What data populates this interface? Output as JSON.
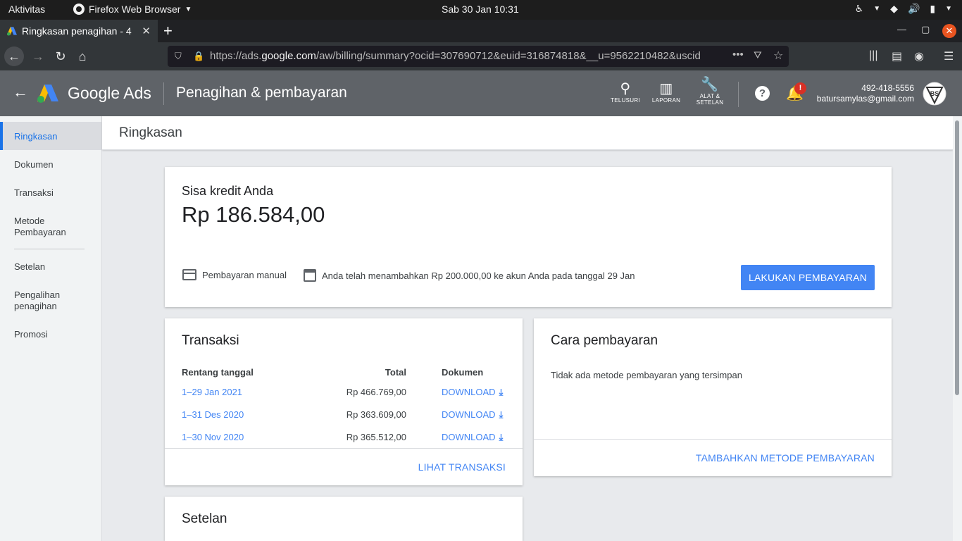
{
  "system_bar": {
    "activities": "Aktivitas",
    "app_name": "Firefox Web Browser",
    "clock": "Sab 30 Jan  10:31"
  },
  "browser": {
    "tab_title": "Ringkasan penagihan - 4",
    "url_prefix": "https://ads.",
    "url_domain": "google.com",
    "url_path": "/aw/billing/summary?ocid=307690712&euid=316874818&__u=9562210482&uscid"
  },
  "ads_header": {
    "brand": "Google Ads",
    "page_title": "Penagihan & pembayaran",
    "tools": {
      "search_label": "TELUSURI",
      "reports_label": "LAPORAN",
      "settings_label_1": "ALAT &",
      "settings_label_2": "SETELAN"
    },
    "notification_badge": "!",
    "account_phone": "492-418-5556",
    "account_email": "batursamylas@gmail.com",
    "avatar_initials": "BS"
  },
  "sidebar": {
    "items": [
      {
        "label": "Ringkasan"
      },
      {
        "label": "Dokumen"
      },
      {
        "label": "Transaksi"
      },
      {
        "label": "Metode Pembayaran"
      },
      {
        "label": "Setelan"
      },
      {
        "label": "Pengalihan penagihan"
      },
      {
        "label": "Promosi"
      }
    ]
  },
  "page": {
    "title": "Ringkasan"
  },
  "credit_card": {
    "label": "Sisa kredit Anda",
    "amount": "Rp 186.584,00",
    "payment_type": "Pembayaran manual",
    "last_payment_note": "Anda telah menambahkan Rp 200.000,00 ke akun Anda pada tanggal 29 Jan",
    "pay_button": "LAKUKAN PEMBAYARAN"
  },
  "transactions": {
    "title": "Transaksi",
    "headers": {
      "range": "Rentang tanggal",
      "total": "Total",
      "document": "Dokumen"
    },
    "rows": [
      {
        "range": "1–29 Jan 2021",
        "total": "Rp 466.769,00",
        "download": "DOWNLOAD"
      },
      {
        "range": "1–31 Des 2020",
        "total": "Rp 363.609,00",
        "download": "DOWNLOAD"
      },
      {
        "range": "1–30 Nov 2020",
        "total": "Rp 365.512,00",
        "download": "DOWNLOAD"
      }
    ],
    "view_link": "LIHAT TRANSAKSI"
  },
  "payment_methods": {
    "title": "Cara pembayaran",
    "empty_text": "Tidak ada metode pembayaran yang tersimpan",
    "add_link": "TAMBAHKAN METODE PEMBAYARAN"
  },
  "settings_card": {
    "title": "Setelan"
  },
  "colors": {
    "accent": "#4285f4",
    "header_bg": "#5f6368",
    "sidebar_active": "#1a73e8",
    "notification": "#d93025"
  }
}
